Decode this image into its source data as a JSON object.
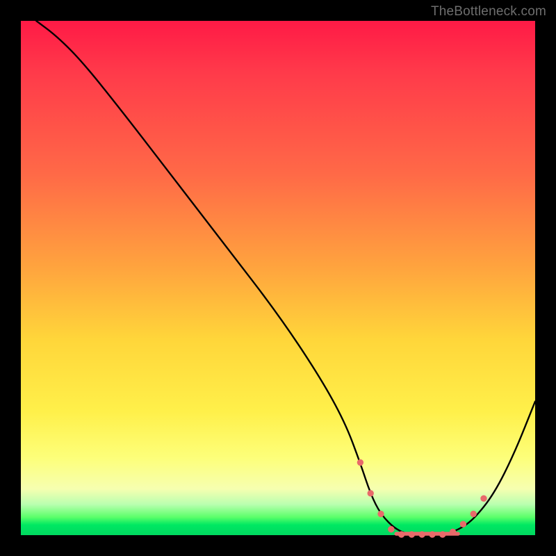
{
  "watermark": "TheBottleneck.com",
  "colors": {
    "gradient_top": "#ff1a46",
    "gradient_mid": "#ffd63a",
    "gradient_bottom": "#00d860",
    "curve": "#000000",
    "markers": "#e86a6a",
    "frame": "#000000"
  },
  "chart_data": {
    "type": "line",
    "title": "",
    "xlabel": "",
    "ylabel": "",
    "xlim": [
      0,
      100
    ],
    "ylim": [
      0,
      100
    ],
    "grid": false,
    "legend": false,
    "note": "Axes are unlabeled; x represents position along the horizontal (roughly 0–100%), y represents bottleneck % (0 = no bottleneck at bottom, 100 = severe at top). Values estimated from pixel positions.",
    "series": [
      {
        "name": "bottleneck-curve",
        "x": [
          3,
          7,
          12,
          20,
          30,
          40,
          50,
          58,
          63,
          66,
          68,
          70,
          73,
          76,
          79,
          82,
          85,
          88,
          92,
          96,
          100
        ],
        "y": [
          100,
          97,
          92,
          82,
          69,
          56,
          43,
          31,
          22,
          14,
          8,
          4,
          1,
          0,
          0,
          0,
          1,
          3,
          8,
          16,
          26
        ]
      }
    ],
    "flat_region": {
      "x_start": 73,
      "x_end": 85,
      "y": 0
    },
    "markers": [
      {
        "x": 66,
        "y": 14
      },
      {
        "x": 68,
        "y": 8
      },
      {
        "x": 70,
        "y": 4
      },
      {
        "x": 72,
        "y": 1
      },
      {
        "x": 74,
        "y": 0
      },
      {
        "x": 76,
        "y": 0
      },
      {
        "x": 78,
        "y": 0
      },
      {
        "x": 80,
        "y": 0
      },
      {
        "x": 82,
        "y": 0
      },
      {
        "x": 84,
        "y": 0.5
      },
      {
        "x": 86,
        "y": 2
      },
      {
        "x": 88,
        "y": 4
      },
      {
        "x": 90,
        "y": 7
      }
    ]
  }
}
